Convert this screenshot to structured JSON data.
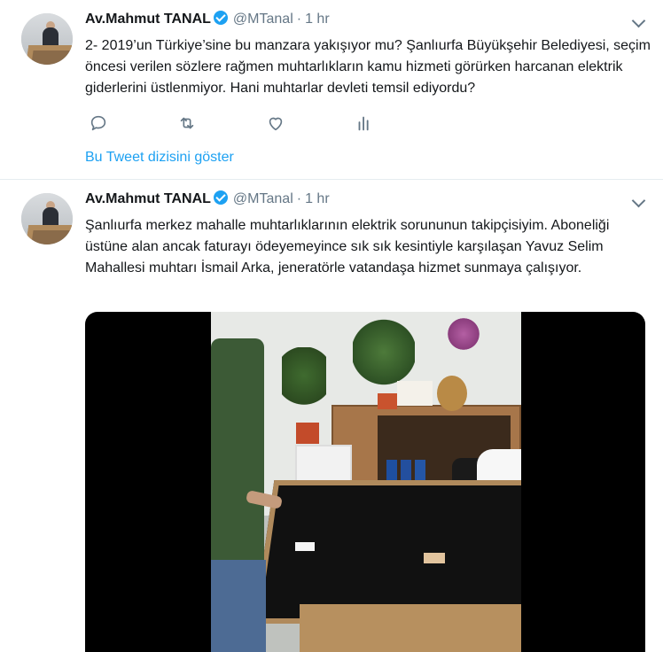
{
  "tweets": [
    {
      "name": "Av.Mahmut TANAL",
      "handle": "@MTanal",
      "separator": "·",
      "time": "1 hr",
      "text": "2- 2019’un Türkiye’sine bu manzara yakışıyor mu? Şanlıurfa Büyükşehir Belediyesi, seçim öncesi verilen sözlere rağmen muhtarlıkların kamu hizmeti görürken harcanan elektrik giderlerini üstlenmiyor. Hani muhtarlar devleti temsil ediyordu?",
      "show_thread": "Bu Tweet dizisini göster"
    },
    {
      "name": "Av.Mahmut TANAL",
      "handle": "@MTanal",
      "separator": "·",
      "time": "1 hr",
      "text": "Şanlıurfa merkez mahalle muhtarlıklarının elektrik sorununun takipçisiyim. Aboneliği üstüne alan ancak faturayı ödeyemeyince sık sık kesintiyle karşılaşan Yavuz Selim Mahallesi muhtarı İsmail Arka, jeneratörle vatandaşa hizmet sunmaya çalışıyor."
    }
  ],
  "icons": {
    "reply": "reply-icon",
    "retweet": "retweet-icon",
    "like": "like-icon",
    "analytics": "analytics-icon",
    "menu": "chevron-down-icon",
    "verified": "verified-badge-icon"
  },
  "colors": {
    "accent": "#1da1f2",
    "muted": "#657786",
    "text": "#14171a"
  }
}
